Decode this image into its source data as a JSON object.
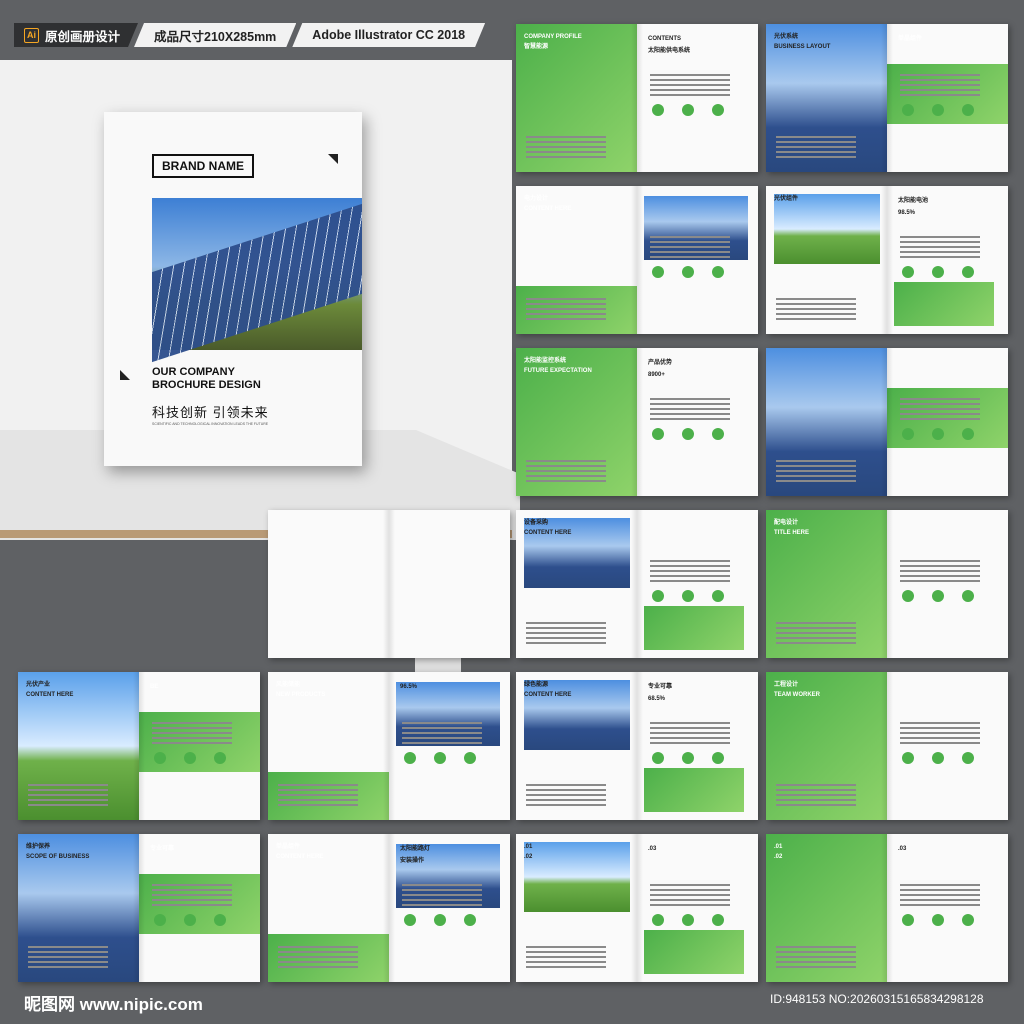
{
  "header": {
    "tag1": "原创画册设计",
    "tag2": "成品尺寸210X285mm",
    "tag3": "Adobe Illustrator CC 2018",
    "ai_icon": "Ai"
  },
  "cover": {
    "brand": "BRAND NAME",
    "line1": "OUR COMPANY",
    "line2": "BROCHURE DESIGN",
    "cn": "科技创新  引领未来",
    "en": "SCIENTIFIC AND TECHNOLOGICAL INNOVATION LEADS THE FUTURE"
  },
  "spreads": [
    {
      "t": "COMPANY PROFILE",
      "s": "智慧能源",
      "r": "CONTENTS",
      "r2": "太阳能供电系统"
    },
    {
      "t": "光伏系统",
      "s": "BUSINESS LAYOUT",
      "r": "单晶组件",
      "r2": ""
    },
    {
      "t": "电力设计",
      "s": "CONTENT HERE",
      "r": "",
      "r2": ""
    },
    {
      "t": "光伏组件",
      "s": "",
      "r": "太阳能电池",
      "r2": "98.5%"
    },
    {
      "t": "太阳能监控系统",
      "s": "FUTURE EXPECTATION",
      "r": "产品优势",
      "r2": "8900+"
    },
    {
      "t": "",
      "s": "",
      "r": "",
      "r2": ""
    },
    {
      "t": "设备采购",
      "s": "CONTENT HERE",
      "r": "",
      "r2": ""
    },
    {
      "t": "配电设计",
      "s": "TITLE HERE",
      "r": "",
      "r2": ""
    },
    {
      "t": "光伏产业",
      "s": "CONTENT HERE",
      "r": "BE",
      "r2": ""
    },
    {
      "t": "风能储能",
      "s": "NEW PRODUCTS",
      "r": "96.5%",
      "r2": ""
    },
    {
      "t": "绿色能源",
      "s": "CONTENT HERE",
      "r": "专业可靠",
      "r2": "68.5%"
    },
    {
      "t": "工程设计",
      "s": "TEAM WORKER",
      "r": "",
      "r2": ""
    },
    {
      "t": "维护保养",
      "s": "SCOPE OF BUSINESS",
      "r": "专业可靠",
      "r2": ""
    },
    {
      "t": "单晶组件",
      "s": "CONTENT HERE",
      "r": "太阳能路灯",
      "r2": "安装操作"
    },
    {
      "t": ".01",
      "s": ".02",
      "r": ".03",
      "r2": ""
    }
  ],
  "footer": {
    "site": "昵图网 www.nipic.com",
    "id": "ID:948153 NO:20260315165834298128"
  }
}
